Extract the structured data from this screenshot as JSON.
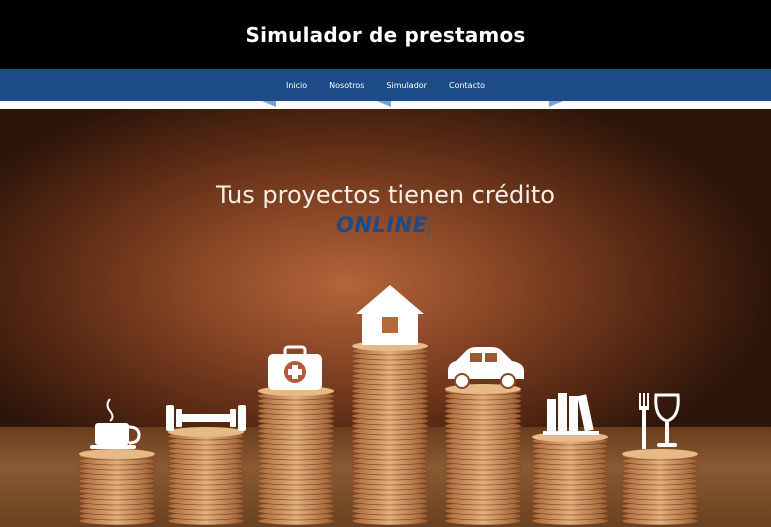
{
  "header": {
    "title": "Simulador de prestamos"
  },
  "nav": {
    "items": [
      {
        "label": "Inicio"
      },
      {
        "label": "Nosotros"
      },
      {
        "label": "Simulador"
      },
      {
        "label": "Contacto"
      }
    ]
  },
  "hero": {
    "title": "Tus proyectos tienen crédito",
    "subtitle": "ONLINE",
    "icons": [
      "coffee-cup-icon",
      "dumbbell-icon",
      "medical-kit-icon",
      "house-icon",
      "car-icon",
      "books-icon",
      "fork-wine-icon"
    ]
  },
  "colors": {
    "topbar": "#000000",
    "navbar": "#1d4b87",
    "accent_text": "#1d4b87"
  }
}
